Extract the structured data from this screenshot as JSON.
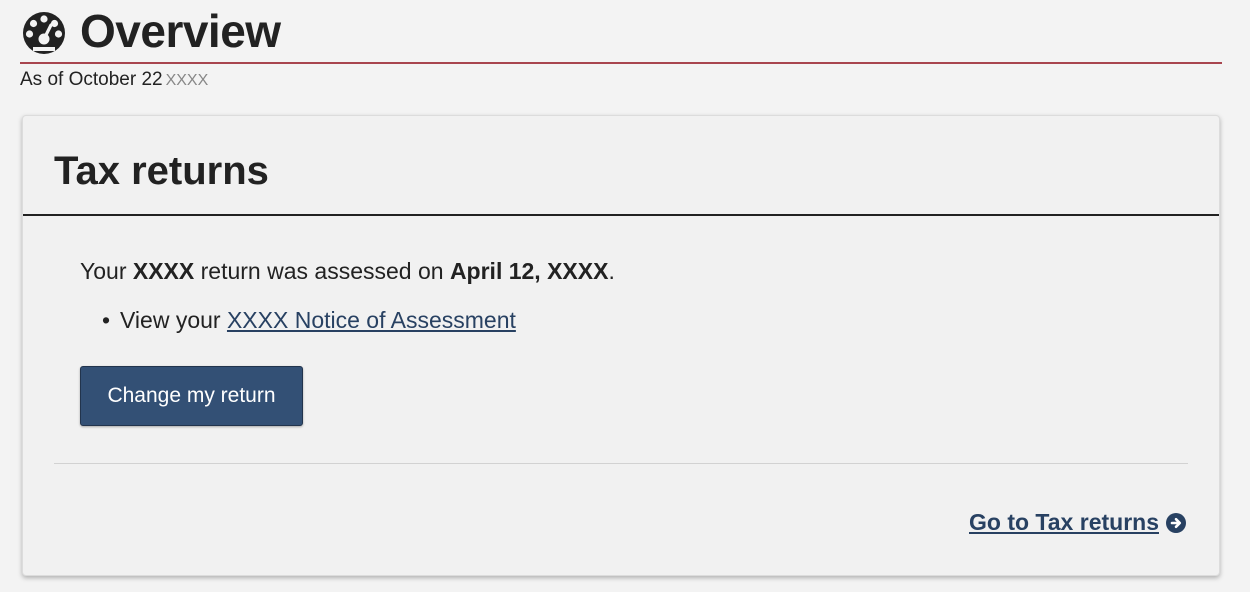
{
  "header": {
    "title": "Overview",
    "icon": "dashboard-icon",
    "as_of_label": "As of October 22",
    "as_of_year": "XXXX",
    "rule_color": "#a8454e"
  },
  "card": {
    "title": "Tax returns",
    "assessed": {
      "prefix": "Your",
      "year": "XXXX",
      "middle": "return was assessed on",
      "date": "April 12, XXXX",
      "suffix": "."
    },
    "notice": {
      "bullet": "•",
      "prefix": "View your",
      "link_text": "XXXX Notice of Assessment"
    },
    "change_button_label": "Change my return",
    "go_to_link": "Go to Tax returns",
    "go_to_icon": "arrow-circle-right-icon",
    "accent_color": "#335075",
    "link_color": "#284162"
  }
}
